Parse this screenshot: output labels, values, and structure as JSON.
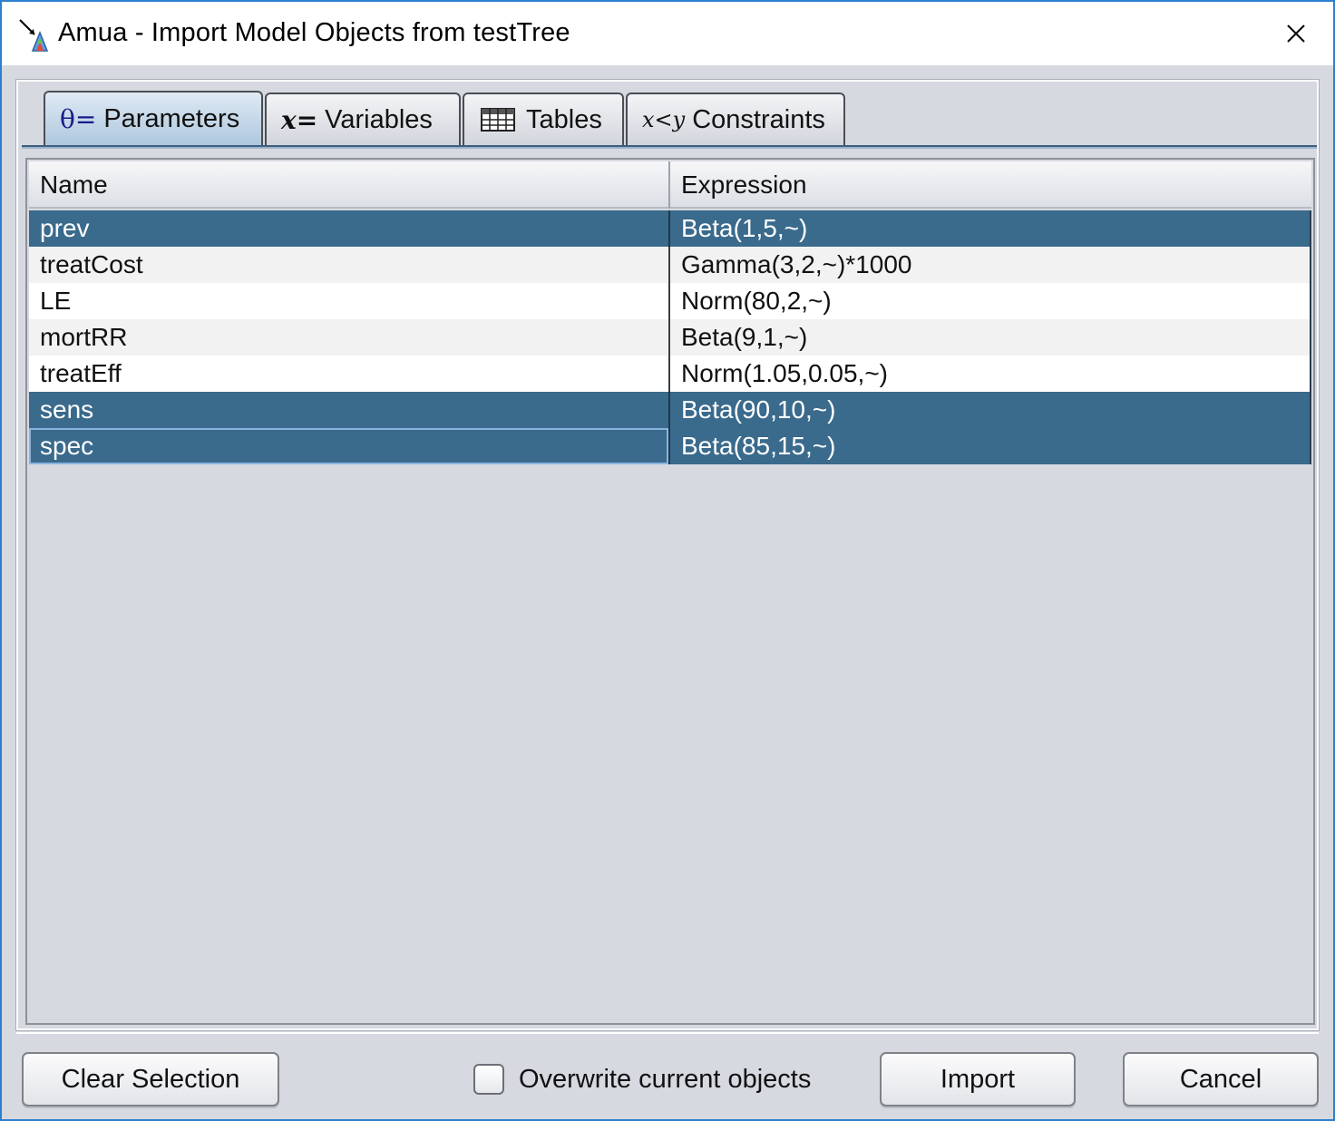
{
  "window": {
    "title": "Amua - Import Model Objects from testTree",
    "close_glyph": "✕"
  },
  "tabs": [
    {
      "icon": "theta-equals-icon",
      "icon_text": "θ=",
      "label": "Parameters",
      "active": true
    },
    {
      "icon": "x-equals-icon",
      "icon_text": "x=",
      "label": "Variables",
      "active": false
    },
    {
      "icon": "table-grid-icon",
      "icon_text": "",
      "label": "Tables",
      "active": false
    },
    {
      "icon": "x-less-than-y-icon",
      "icon_text": "x<y",
      "label": "Constraints",
      "active": false
    }
  ],
  "table": {
    "columns": [
      "Name",
      "Expression"
    ],
    "rows": [
      {
        "name": "prev",
        "expression": "Beta(1,5,~)",
        "selected": true
      },
      {
        "name": "treatCost",
        "expression": "Gamma(3,2,~)*1000",
        "selected": false
      },
      {
        "name": "LE",
        "expression": "Norm(80,2,~)",
        "selected": false
      },
      {
        "name": "mortRR",
        "expression": "Beta(9,1,~)",
        "selected": false
      },
      {
        "name": "treatEff",
        "expression": "Norm(1.05,0.05,~)",
        "selected": false
      },
      {
        "name": "sens",
        "expression": "Beta(90,10,~)",
        "selected": true
      },
      {
        "name": "spec",
        "expression": "Beta(85,15,~)",
        "selected": true
      }
    ]
  },
  "footer": {
    "clear_label": "Clear Selection",
    "overwrite_label": "Overwrite current objects",
    "overwrite_checked": false,
    "import_label": "Import",
    "cancel_label": "Cancel"
  },
  "colors": {
    "selected_row": "#3a6a8c",
    "row_even": "#f2f2f2",
    "row_odd": "#ffffff",
    "window_border": "#2d7fd0",
    "panel_bg": "#d6d9e0"
  }
}
